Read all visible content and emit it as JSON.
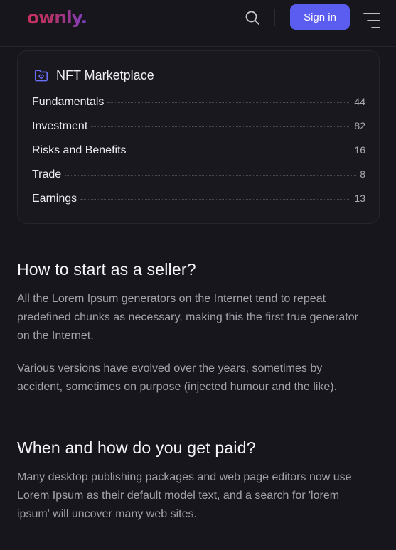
{
  "header": {
    "logo_text": "ownly.",
    "sign_in_label": "Sign in",
    "accent_color": "#5b5cf0"
  },
  "toc": {
    "title": "NFT Marketplace",
    "icon": "folder-heart-icon",
    "items": [
      {
        "label": "Fundamentals",
        "count": "44"
      },
      {
        "label": "Investment",
        "count": "82"
      },
      {
        "label": "Risks and Benefits",
        "count": "16"
      },
      {
        "label": "Trade",
        "count": "8"
      },
      {
        "label": "Earnings",
        "count": "13"
      }
    ]
  },
  "article": {
    "sections": [
      {
        "heading": "How to start as a seller?",
        "paragraphs": [
          "All the Lorem Ipsum generators on the Internet tend to repeat predefined chunks as necessary, making this the first true generator on the Internet.",
          "Various versions have evolved over the years, sometimes by accident, sometimes on purpose (injected humour and the like)."
        ]
      },
      {
        "heading": "When and how do you get paid?",
        "paragraphs": [
          "Many desktop publishing packages and web page editors now use Lorem Ipsum as their default model text, and a search for 'lorem ipsum' will uncover many web sites."
        ]
      }
    ]
  }
}
